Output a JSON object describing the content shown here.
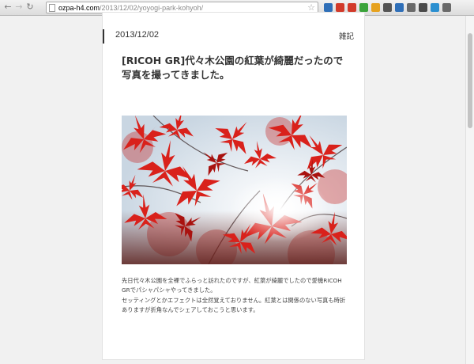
{
  "browser": {
    "url_host": "ozpa-h4.com",
    "url_path": "/2013/12/02/yoyogi-park-kohyoh/",
    "extension_icons": [
      {
        "name": "extension-icon-1",
        "color": "#2f6fb8"
      },
      {
        "name": "extension-icon-2",
        "color": "#d23a2a"
      },
      {
        "name": "extension-icon-3",
        "color": "#d23a2a"
      },
      {
        "name": "extension-icon-4",
        "color": "#3aa33a"
      },
      {
        "name": "extension-icon-5",
        "color": "#e6a21f"
      },
      {
        "name": "extension-icon-6",
        "color": "#555555"
      },
      {
        "name": "extension-icon-7",
        "color": "#2f6fb8"
      },
      {
        "name": "extension-icon-8",
        "color": "#6a6a6a"
      },
      {
        "name": "extension-icon-9",
        "color": "#4a4a4a"
      },
      {
        "name": "extension-icon-10",
        "color": "#2a8fd0"
      },
      {
        "name": "extension-icon-11",
        "color": "#6a6a6a"
      }
    ]
  },
  "article": {
    "date": "2013/12/02",
    "category": "雑記",
    "title": "[RICOH GR]代々木公園の紅葉が綺麗だったので写真を撮ってきました。",
    "photo_icon": "autumn-maple-leaves-photo",
    "paragraphs": [
      "先日代々木公園を全裸でふらっと訪れたのですが、紅葉が綺麗でしたので愛機RICOH GRでパシャパシャやってきました。",
      "セッティングとかエフェクトは全然覚えておりません。紅葉とは関係のない写真も時折ありますが折角なんでシェアしておこうと思います。"
    ]
  },
  "colors": {
    "accent_leaf": "#d9211b",
    "page_background": "#f1f1f1"
  }
}
